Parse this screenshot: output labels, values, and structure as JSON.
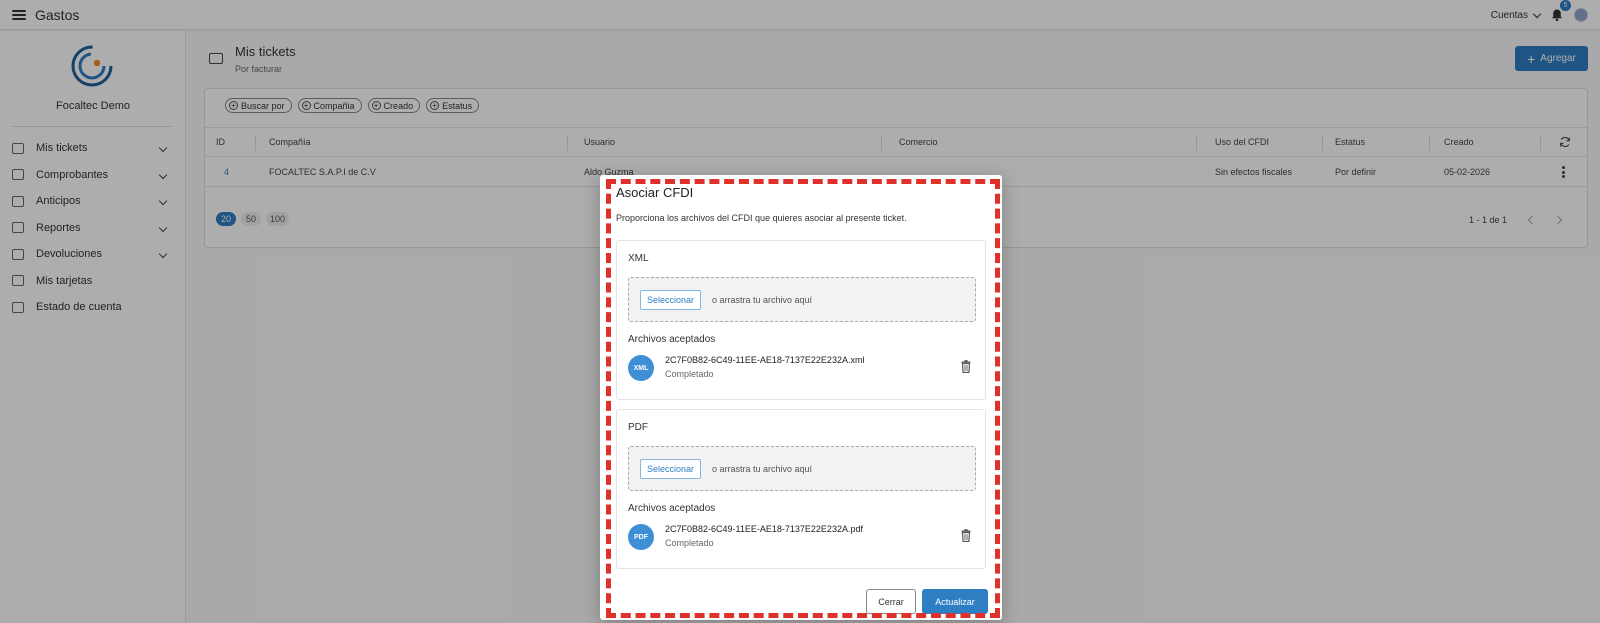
{
  "app": {
    "title": "Gastos"
  },
  "topbar": {
    "accounts_label": "Cuentas",
    "notifications_count": "5"
  },
  "sidebar": {
    "company_name": "Focaltec Demo",
    "items": [
      {
        "label": "Mis tickets",
        "expandable": true
      },
      {
        "label": "Comprobantes",
        "expandable": true
      },
      {
        "label": "Anticipos",
        "expandable": true
      },
      {
        "label": "Reportes",
        "expandable": true
      },
      {
        "label": "Devoluciones",
        "expandable": true
      },
      {
        "label": "Mis tarjetas",
        "expandable": false
      },
      {
        "label": "Estado de cuenta",
        "expandable": false
      }
    ]
  },
  "header": {
    "title": "Mis tickets",
    "subtitle": "Por facturar",
    "add_label": "Agregar"
  },
  "filters": [
    "Buscar por",
    "Compañia",
    "Creado",
    "Estatus"
  ],
  "table": {
    "columns": [
      "ID",
      "Compañía",
      "Usuario",
      "Comercio",
      "Uso del CFDI",
      "Estatus",
      "Creado"
    ],
    "rows": [
      [
        "4",
        "FOCALTEC S.A.P.I de C.V",
        "Aldo Guzma",
        "",
        "Sin efectos fiscales",
        "Por definir",
        "05-02-2026"
      ]
    ]
  },
  "pagination": {
    "sizes": [
      "20",
      "50",
      "100"
    ],
    "selected": "20",
    "range": "1 - 1 de 1"
  },
  "modal": {
    "title": "Asociar CFDI",
    "description": "Proporciona los archivos del CFDI que quieres asociar al presente ticket.",
    "sections": [
      {
        "title": "XML",
        "select_label": "Seleccionar",
        "drop_text": "o arrastra tu archivo aquí",
        "accepted_title": "Archivos aceptados",
        "file_badge": "XML",
        "file_name": "2C7F0B82-6C49-11EE-AE18-7137E22E232A.xml",
        "file_status": "Completado"
      },
      {
        "title": "PDF",
        "select_label": "Seleccionar",
        "drop_text": "o arrastra tu archivo aquí",
        "accepted_title": "Archivos aceptados",
        "file_badge": "PDF",
        "file_name": "2C7F0B82-6C49-11EE-AE18-7137E22E232A.pdf",
        "file_status": "Completado"
      }
    ],
    "close_label": "Cerrar",
    "update_label": "Actualizar"
  },
  "colors": {
    "primary": "#2e7ec4",
    "highlight_frame": "#e0302a"
  }
}
